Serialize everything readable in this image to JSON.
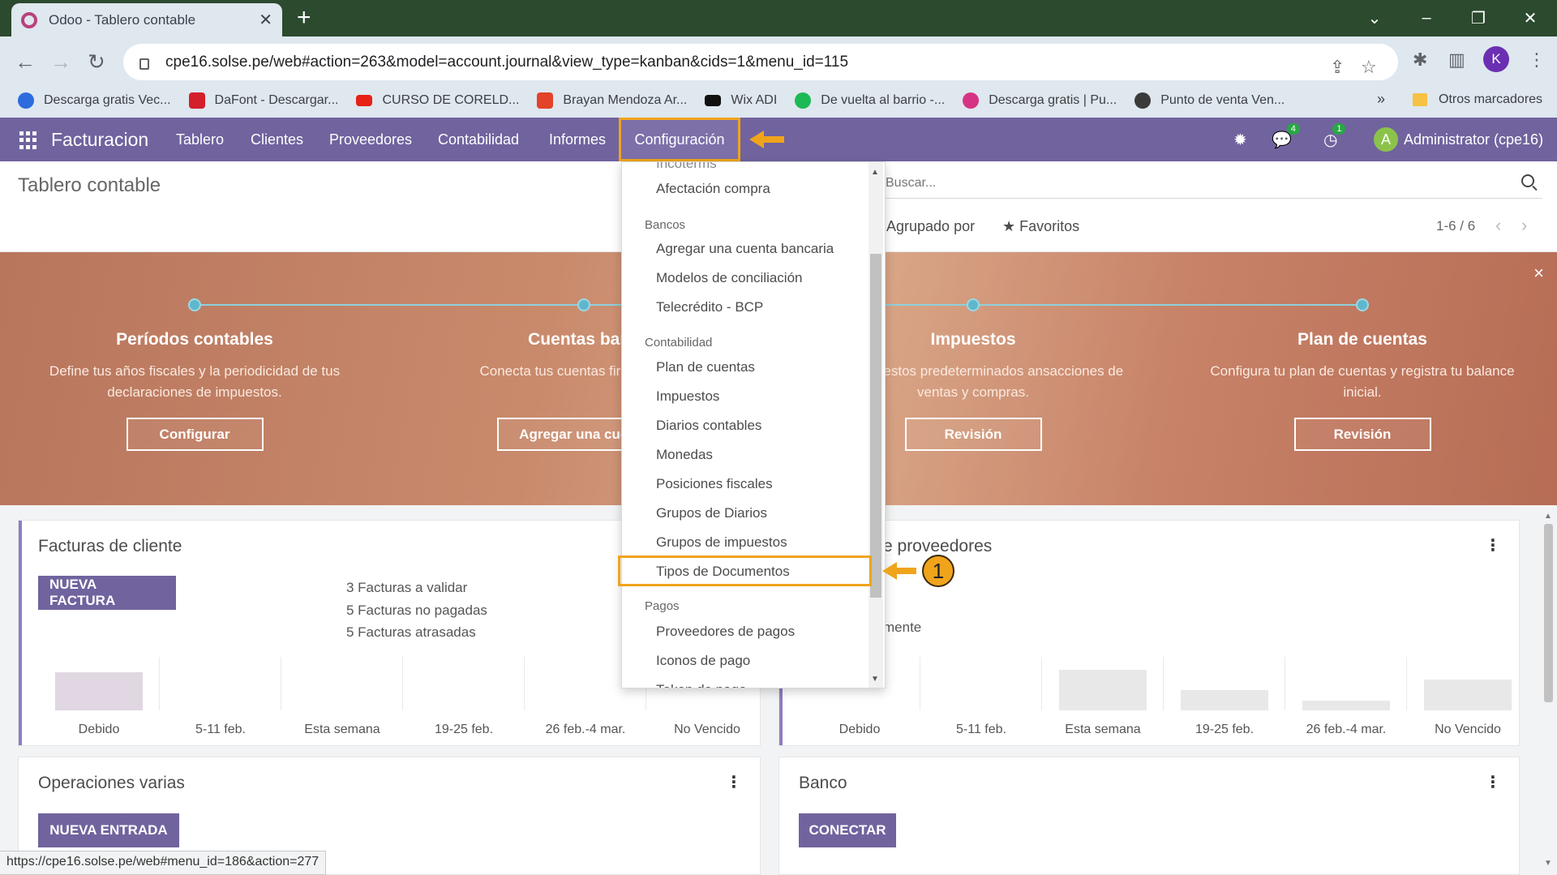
{
  "browser": {
    "tab_title": "Odoo - Tablero contable",
    "url": "cpe16.solse.pe/web#action=263&model=account.journal&view_type=kanban&cids=1&menu_id=115",
    "profile_initial": "K",
    "bookmarks": [
      {
        "label": "Descarga gratis Vec...",
        "color": "#2d6cdf"
      },
      {
        "label": "DaFont - Descargar...",
        "color": "#d4202b"
      },
      {
        "label": "CURSO DE CORELD...",
        "color": "#e62117"
      },
      {
        "label": "Brayan Mendoza Ar...",
        "color": "#e24329"
      },
      {
        "label": "Wix ADI",
        "color": "#111111"
      },
      {
        "label": "De vuelta al barrio -...",
        "color": "#1db954"
      },
      {
        "label": "Descarga gratis | Pu...",
        "color": "#d63384"
      },
      {
        "label": "Punto de venta Ven...",
        "color": "#3a3a3a"
      }
    ],
    "bookmarks_more": "»",
    "other_bookmarks": "Otros marcadores",
    "status_url": "https://cpe16.solse.pe/web#menu_id=186&action=277"
  },
  "odoo_nav": {
    "brand": "Facturacion",
    "menu": [
      "Tablero",
      "Clientes",
      "Proveedores",
      "Contabilidad",
      "Informes"
    ],
    "config": "Configuración",
    "chat_badge": "4",
    "activity_badge": "1",
    "admin_initial": "A",
    "admin_name": "Administrator (cpe16)"
  },
  "control_panel": {
    "title": "Tablero contable",
    "search_placeholder": "Buscar...",
    "groupby": "Agrupado por",
    "favorites": "Favoritos",
    "pager": "1-6 / 6"
  },
  "banner": {
    "close": "×",
    "steps": [
      {
        "title": "Períodos contables",
        "desc": "Define tus años fiscales y la periodicidad de tus declaraciones de impuestos.",
        "button": "Configurar"
      },
      {
        "title": "Cuentas banc",
        "desc": "Conecta tus cuentas fir segundos.",
        "button": "Agregar una cuenta"
      },
      {
        "title": "Impuestos",
        "desc": "ecer impuestos predeterminados ansacciones de ventas y compras.",
        "button": "Revisión"
      },
      {
        "title": "Plan de cuentas",
        "desc": "Configura tu plan de cuentas y registra tu balance inicial.",
        "button": "Revisión"
      }
    ]
  },
  "cards": {
    "customer": {
      "title": "Facturas de cliente",
      "button": "NUEVA FACTURA",
      "stats": [
        "3 Facturas a validar",
        "5 Facturas no pagadas",
        "5 Facturas atrasadas"
      ],
      "labels": [
        "Debido",
        "5-11 feb.",
        "Esta semana",
        "19-25 feb.",
        "26 feb.-4 mar.",
        "No Vencido"
      ],
      "values": [
        0.78,
        0,
        0,
        0,
        0,
        0
      ]
    },
    "vendor": {
      "title": "e proveedores",
      "partial_stat": "mente",
      "labels": [
        "Debido",
        "5-11 feb.",
        "Esta semana",
        "19-25 feb.",
        "26 feb.-4 mar.",
        "No Vencido"
      ],
      "values": [
        0,
        0,
        0.84,
        0.42,
        0.2,
        0.64
      ]
    },
    "misc": {
      "title": "Operaciones varias",
      "button": "NUEVA ENTRADA"
    },
    "bank": {
      "title": "Banco",
      "button": "CONECTAR"
    }
  },
  "dropdown": {
    "cut_top": "Incoterms",
    "item_top": "Afectación compra",
    "bancos_header": "Bancos",
    "bancos": [
      "Agregar una cuenta bancaria",
      "Modelos de conciliación",
      "Telecrédito - BCP"
    ],
    "contabilidad_header": "Contabilidad",
    "contabilidad": [
      "Plan de cuentas",
      "Impuestos",
      "Diarios contables",
      "Monedas",
      "Posiciones fiscales",
      "Grupos de Diarios",
      "Grupos de impuestos",
      "Tipos de Documentos"
    ],
    "pagos_header": "Pagos",
    "pagos": [
      "Proveedores de pagos",
      "Iconos de pago",
      "Token de pago"
    ],
    "callout_number": "1"
  },
  "colors": {
    "odoo_primary": "#71639e",
    "annotation": "#f0a41c",
    "chrome_tabbar": "#2b4a2e"
  }
}
